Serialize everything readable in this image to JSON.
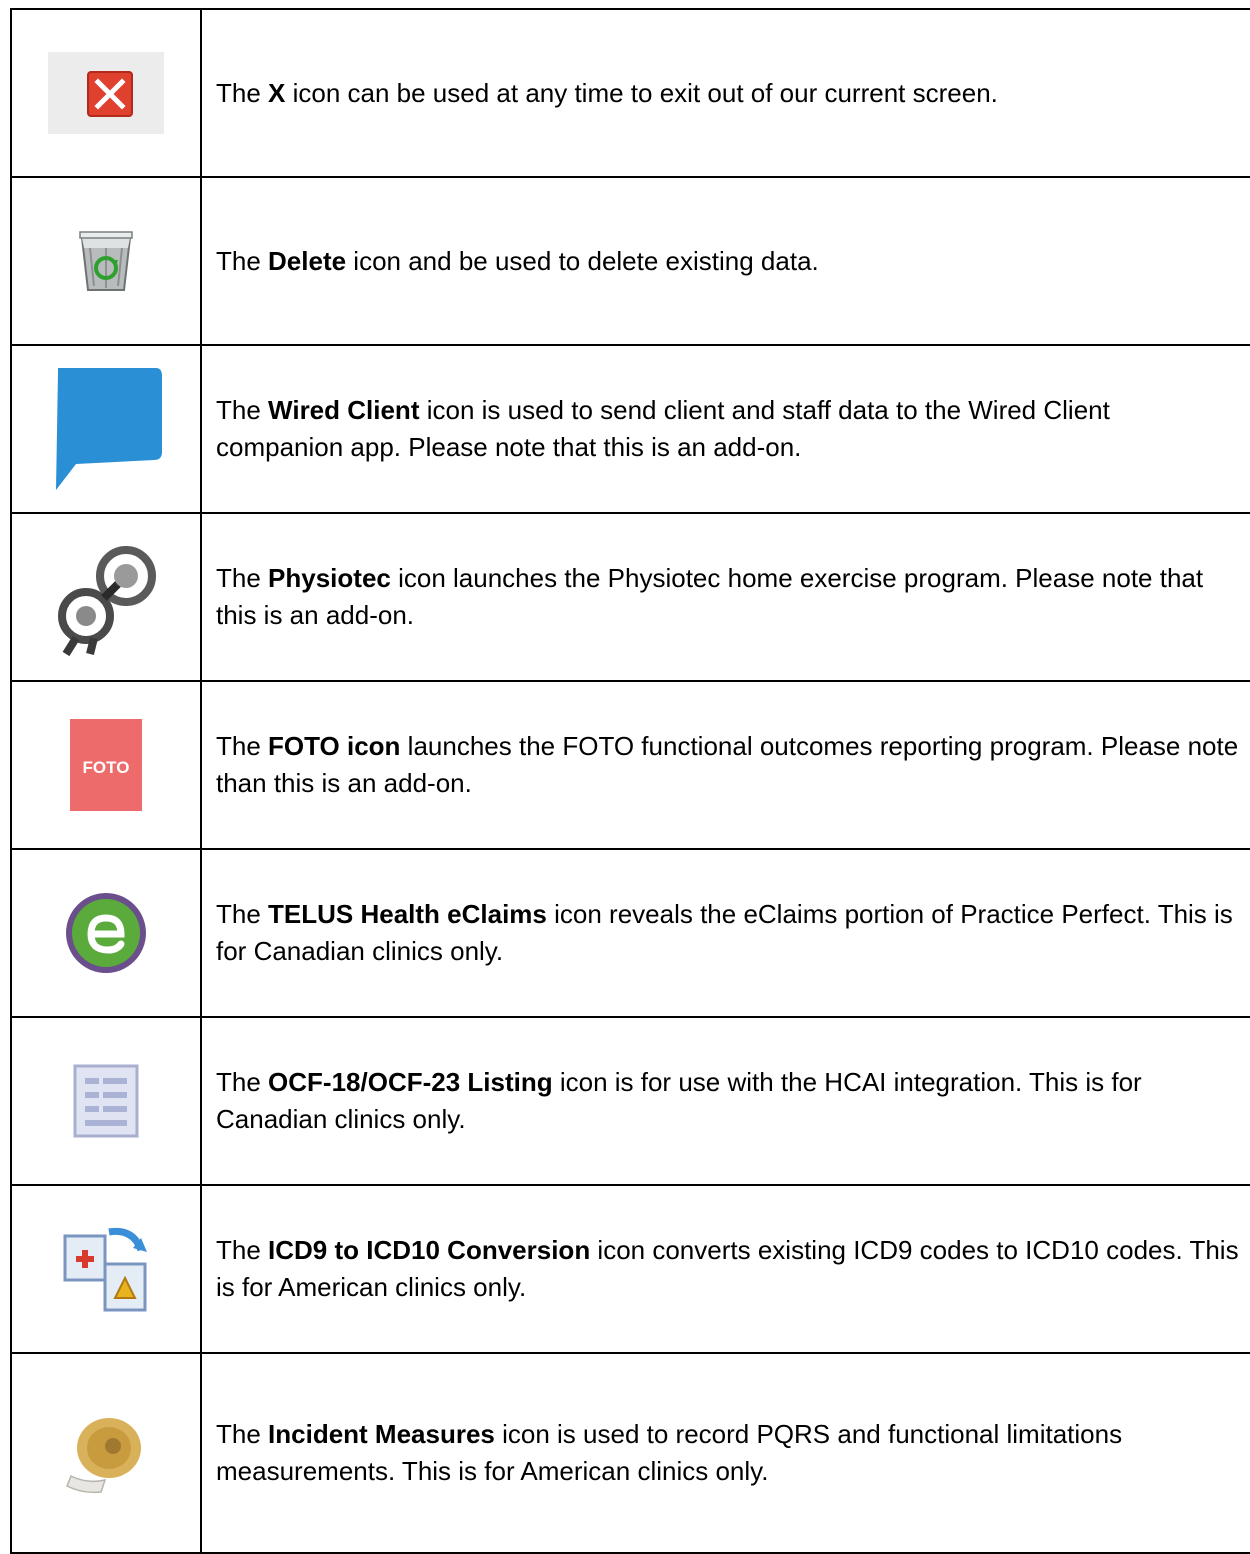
{
  "rows": [
    {
      "icon": "close-icon",
      "prefix": "The ",
      "bold": "X",
      "rest": " icon can be used at any time to exit out of our current screen."
    },
    {
      "icon": "delete-recycle-bin-icon",
      "prefix": "The ",
      "bold": "Delete",
      "rest": " icon and be used to delete existing data."
    },
    {
      "icon": "wired-client-speech-bubble-icon",
      "prefix": "The ",
      "bold": "Wired Client",
      "rest": " icon is used to send client and staff data to the Wired Client companion app. Please note that this is an add-on."
    },
    {
      "icon": "physiotec-icon",
      "prefix": "The ",
      "bold": "Physiotec",
      "rest": " icon launches the Physiotec home exercise program. Please note that this is an add-on."
    },
    {
      "icon": "foto-icon",
      "icon_text": "FOTO",
      "prefix": "The ",
      "bold": "FOTO icon",
      "rest": " launches the FOTO functional outcomes reporting program. Please note than this is an add-on."
    },
    {
      "icon": "telus-eclaims-icon",
      "prefix": "The ",
      "bold": "TELUS Health eClaims",
      "rest": " icon reveals the eClaims portion of Practice Perfect. This is for Canadian clinics only."
    },
    {
      "icon": "ocf-listing-document-icon",
      "prefix": "The ",
      "bold": "OCF-18/OCF-23 Listing",
      "rest": " icon is for use with the HCAI integration. This is for Canadian clinics only."
    },
    {
      "icon": "icd-conversion-icon",
      "prefix": "The ",
      "bold": "ICD9 to ICD10 Conversion",
      "rest": " icon converts existing ICD9 codes to ICD10 codes. This is for American clinics only."
    },
    {
      "icon": "measuring-tape-icon",
      "prefix": "The ",
      "bold": "Incident Measures",
      "rest": " icon is used to record PQRS and functional limitations measurements. This is for American clinics only."
    }
  ],
  "colors": {
    "close_red": "#e0402e",
    "wired_blue": "#2b8fd6",
    "foto_red": "#ee6b6b",
    "eclaims_green": "#5aab3c",
    "eclaims_ring": "#6b4f8c"
  }
}
